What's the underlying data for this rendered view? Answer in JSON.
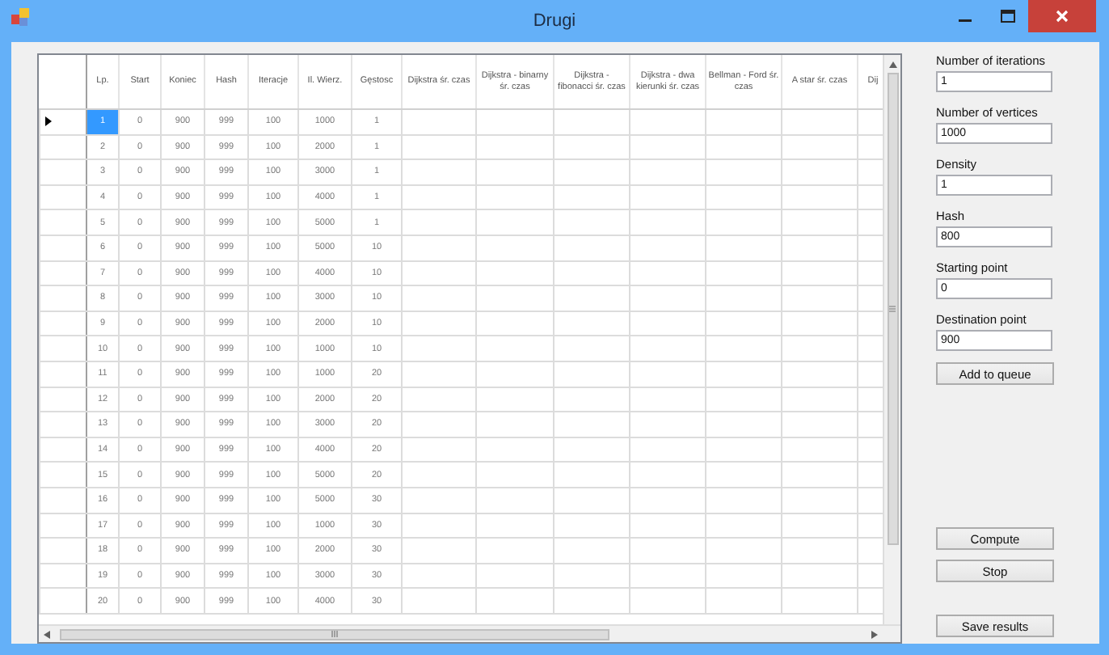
{
  "window": {
    "title": "Drugi"
  },
  "table": {
    "columns": [
      "Lp.",
      "Start",
      "Koniec",
      "Hash",
      "Iteracje",
      "Il. Wierz.",
      "Gęstosc",
      "Dijkstra śr. czas",
      "Dijkstra - binarny śr. czas",
      "Dijkstra - fibonacci śr. czas",
      "Dijkstra - dwa kierunki śr. czas",
      "Bellman - Ford śr. czas",
      "A star śr. czas",
      "Dij"
    ],
    "rows": [
      {
        "selected": true,
        "cells": [
          "1",
          "0",
          "900",
          "999",
          "100",
          "1000",
          "1"
        ]
      },
      {
        "selected": false,
        "cells": [
          "2",
          "0",
          "900",
          "999",
          "100",
          "2000",
          "1"
        ]
      },
      {
        "selected": false,
        "cells": [
          "3",
          "0",
          "900",
          "999",
          "100",
          "3000",
          "1"
        ]
      },
      {
        "selected": false,
        "cells": [
          "4",
          "0",
          "900",
          "999",
          "100",
          "4000",
          "1"
        ]
      },
      {
        "selected": false,
        "cells": [
          "5",
          "0",
          "900",
          "999",
          "100",
          "5000",
          "1"
        ]
      },
      {
        "selected": false,
        "cells": [
          "6",
          "0",
          "900",
          "999",
          "100",
          "5000",
          "10"
        ]
      },
      {
        "selected": false,
        "cells": [
          "7",
          "0",
          "900",
          "999",
          "100",
          "4000",
          "10"
        ]
      },
      {
        "selected": false,
        "cells": [
          "8",
          "0",
          "900",
          "999",
          "100",
          "3000",
          "10"
        ]
      },
      {
        "selected": false,
        "cells": [
          "9",
          "0",
          "900",
          "999",
          "100",
          "2000",
          "10"
        ]
      },
      {
        "selected": false,
        "cells": [
          "10",
          "0",
          "900",
          "999",
          "100",
          "1000",
          "10"
        ]
      },
      {
        "selected": false,
        "cells": [
          "11",
          "0",
          "900",
          "999",
          "100",
          "1000",
          "20"
        ]
      },
      {
        "selected": false,
        "cells": [
          "12",
          "0",
          "900",
          "999",
          "100",
          "2000",
          "20"
        ]
      },
      {
        "selected": false,
        "cells": [
          "13",
          "0",
          "900",
          "999",
          "100",
          "3000",
          "20"
        ]
      },
      {
        "selected": false,
        "cells": [
          "14",
          "0",
          "900",
          "999",
          "100",
          "4000",
          "20"
        ]
      },
      {
        "selected": false,
        "cells": [
          "15",
          "0",
          "900",
          "999",
          "100",
          "5000",
          "20"
        ]
      },
      {
        "selected": false,
        "cells": [
          "16",
          "0",
          "900",
          "999",
          "100",
          "5000",
          "30"
        ]
      },
      {
        "selected": false,
        "cells": [
          "17",
          "0",
          "900",
          "999",
          "100",
          "1000",
          "30"
        ]
      },
      {
        "selected": false,
        "cells": [
          "18",
          "0",
          "900",
          "999",
          "100",
          "2000",
          "30"
        ]
      },
      {
        "selected": false,
        "cells": [
          "19",
          "0",
          "900",
          "999",
          "100",
          "3000",
          "30"
        ]
      },
      {
        "selected": false,
        "cells": [
          "20",
          "0",
          "900",
          "999",
          "100",
          "4000",
          "30"
        ]
      }
    ]
  },
  "side_panel": {
    "fields": [
      {
        "label": "Number of iterations",
        "value": "1"
      },
      {
        "label": "Number of vertices",
        "value": "1000"
      },
      {
        "label": "Density",
        "value": "1"
      },
      {
        "label": "Hash",
        "value": "800"
      },
      {
        "label": "Starting point",
        "value": "0"
      },
      {
        "label": "Destination point",
        "value": "900"
      }
    ],
    "queue_button": "Add to queue",
    "buttons": [
      "Compute",
      "Stop"
    ],
    "save_button": "Save results"
  }
}
